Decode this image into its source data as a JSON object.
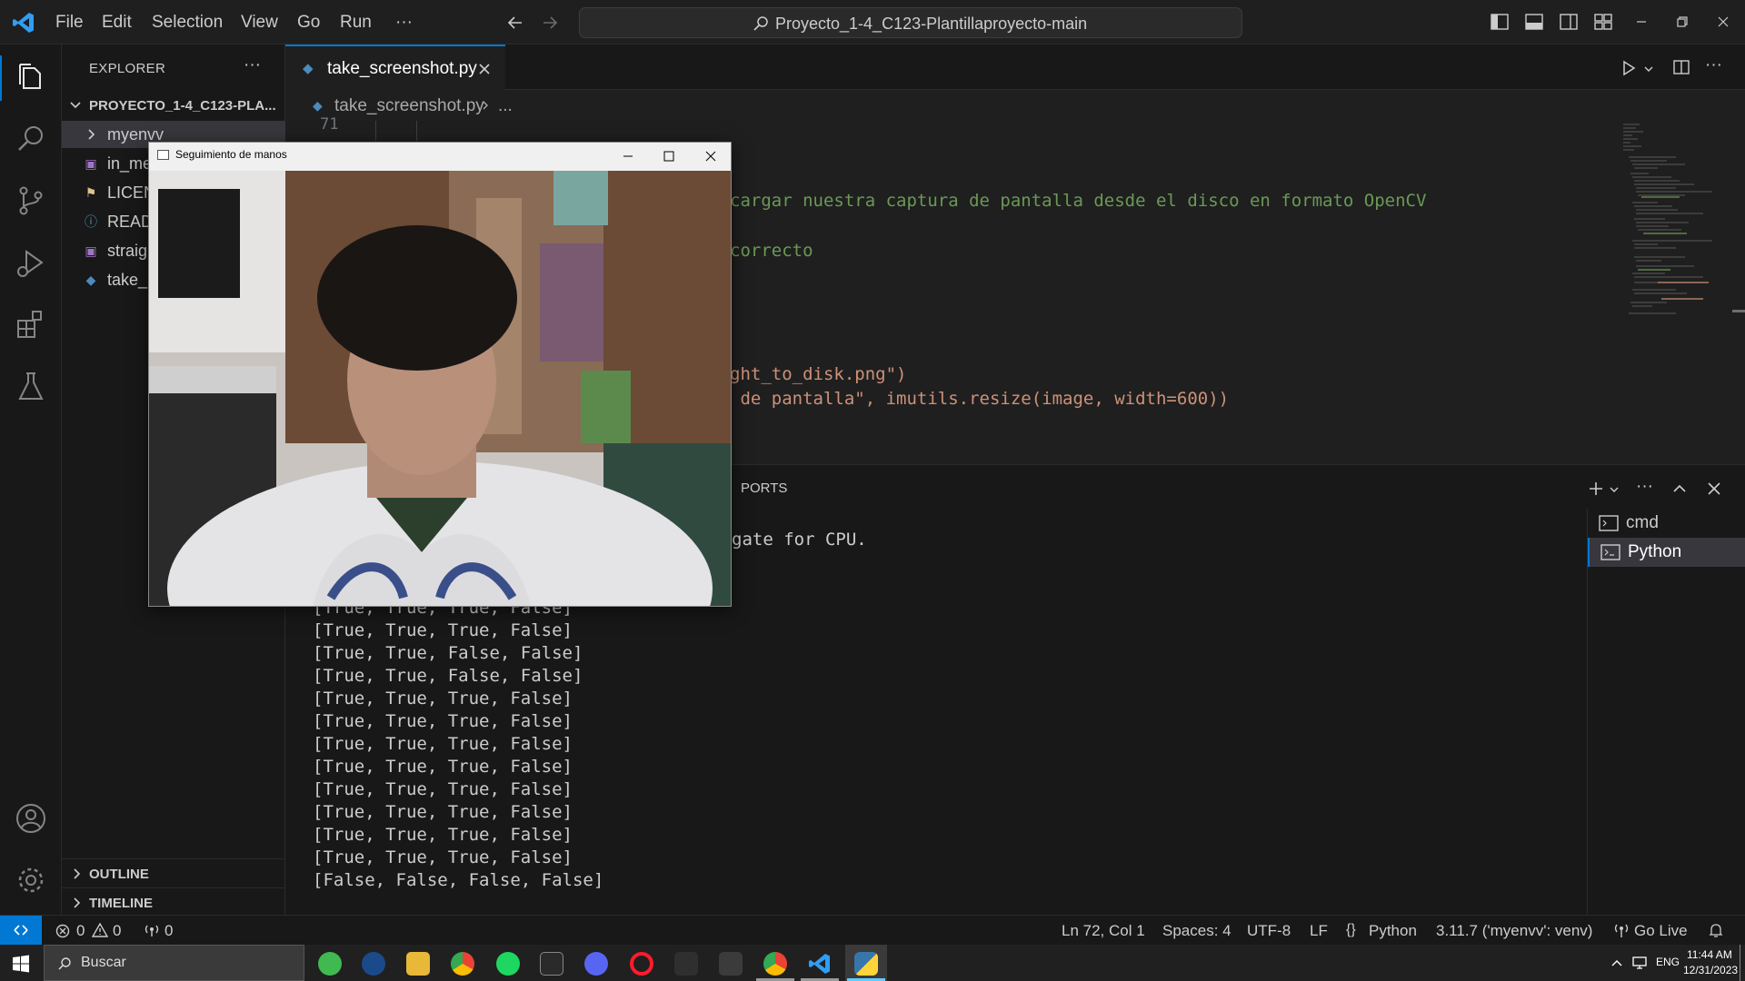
{
  "titlebar": {
    "menu": [
      "File",
      "Edit",
      "Selection",
      "View",
      "Go",
      "Run",
      "···"
    ],
    "search_text": "Proyecto_1-4_C123-Plantillaproyecto-main"
  },
  "sidebar": {
    "title": "EXPLORER",
    "more": "···",
    "root": "PROYECTO_1-4_C123-PLA...",
    "items": [
      {
        "label": "myenvv",
        "icon": "chevron-right-icon"
      },
      {
        "label": "in_me",
        "icon": "image-file-icon"
      },
      {
        "label": "LICEN",
        "icon": "license-icon"
      },
      {
        "label": "READ",
        "icon": "info-icon"
      },
      {
        "label": "straig",
        "icon": "image-file-icon"
      },
      {
        "label": "take_",
        "icon": "python-file-icon"
      }
    ],
    "outline": "OUTLINE",
    "timeline": "TIMELINE"
  },
  "editor": {
    "tab": "take_screenshot.py",
    "breadcrumb_file": "take_screenshot.py",
    "breadcrumb_more": "...",
    "line_number": "71",
    "lines": [
      "cargar nuestra captura de pantalla desde el disco en formato OpenCV",
      "correcto",
      "ght_to_disk.png\")",
      " de pantalla\", imutils.resize(image, width=600))"
    ]
  },
  "panel": {
    "tab_label": "PORTS",
    "first_line": "gate for CPU.",
    "output": [
      "[True, True, True, False]",
      "[True, True, True, False]",
      "[True, True, False, False]",
      "[True, True, False, False]",
      "[True, True, True, False]",
      "[True, True, True, False]",
      "[True, True, True, False]",
      "[True, True, True, False]",
      "[True, True, True, False]",
      "[True, True, True, False]",
      "[True, True, True, False]",
      "[True, True, True, False]",
      "[False, False, False, False]"
    ],
    "terminals": [
      "cmd",
      "Python"
    ]
  },
  "camera_window": {
    "title": "Seguimiento de manos"
  },
  "statusbar": {
    "errors": "0",
    "warnings": "0",
    "ports": "0",
    "position": "Ln 72, Col 1",
    "spaces": "Spaces: 4",
    "encoding": "UTF-8",
    "eol": "LF",
    "language": "Python",
    "interpreter": "3.11.7 ('myenvv': venv)",
    "golive": "Go Live"
  },
  "taskbar": {
    "search_placeholder": "Buscar",
    "lang": "ENG",
    "time": "11:44 AM",
    "date": "12/31/2023"
  },
  "colors": {
    "accent": "#0078d4",
    "comment": "#6a9955",
    "string": "#ce9178",
    "statusbar": "#181818"
  }
}
